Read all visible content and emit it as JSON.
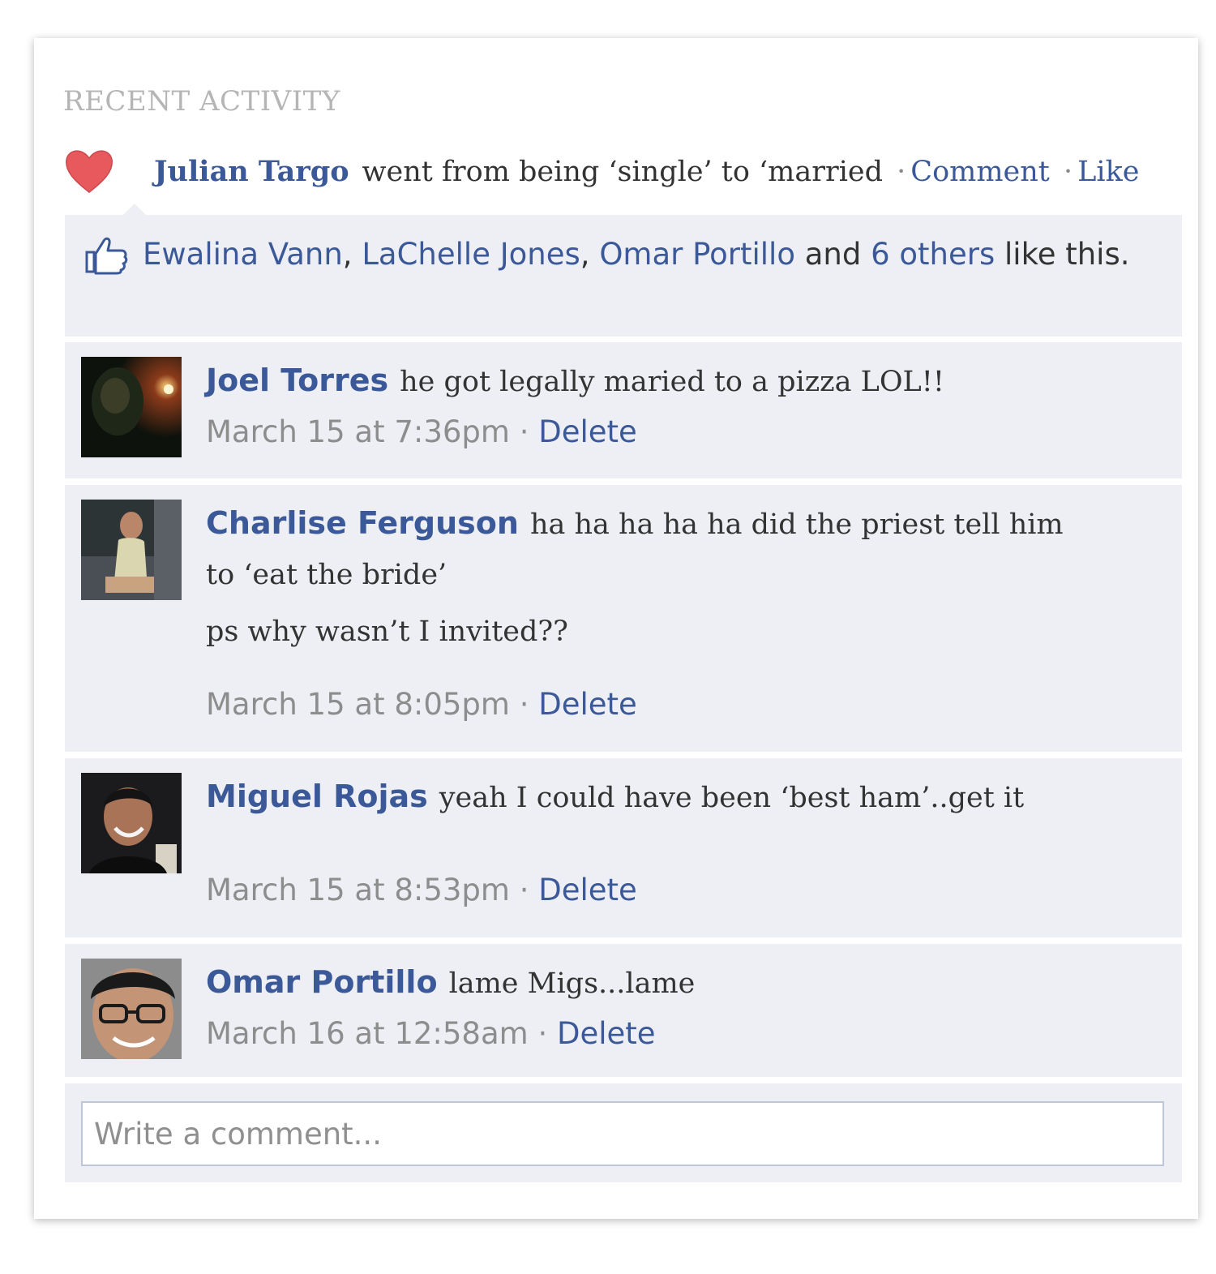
{
  "section_title": "RECENT ACTIVITY",
  "story": {
    "actor": "Julian Targo",
    "action": "went from being ‘single’ to ‘married",
    "separator": "·",
    "comment_link": "Comment",
    "like_link": "Like",
    "icon": "heart-icon",
    "heart_color": "#e8595d"
  },
  "likes": {
    "icon": "thumbs-up-icon",
    "names": [
      "Ewalina Vann",
      "LaChelle Jones",
      "Omar Portillo"
    ],
    "comma": ",",
    "and": "and",
    "others": "6 others",
    "suffix": "like this."
  },
  "comments": [
    {
      "author": "Joel Torres",
      "lines": [
        "he got legally maried to a pizza LOL!!"
      ],
      "timestamp": "March 15 at 7:36pm",
      "separator": "·",
      "delete_label": "Delete"
    },
    {
      "author": "Charlise Ferguson",
      "lines": [
        "ha ha ha ha ha did the priest tell him",
        "to ‘eat the bride’",
        "ps why wasn’t I invited??"
      ],
      "timestamp": "March 15 at 8:05pm",
      "separator": "·",
      "delete_label": "Delete"
    },
    {
      "author": "Miguel Rojas",
      "lines": [
        "yeah I could have been ‘best ham’..get it"
      ],
      "timestamp": "March 15 at 8:53pm",
      "separator": "·",
      "delete_label": "Delete"
    },
    {
      "author": "Omar Portillo",
      "lines": [
        "lame Migs...lame"
      ],
      "timestamp": "March 16 at 12:58am",
      "separator": "·",
      "delete_label": "Delete"
    }
  ],
  "composer": {
    "placeholder": "Write a comment..."
  },
  "colors": {
    "link": "#3b5998",
    "ufi_background": "#edeff4",
    "meta_text": "#8d8d8d"
  }
}
